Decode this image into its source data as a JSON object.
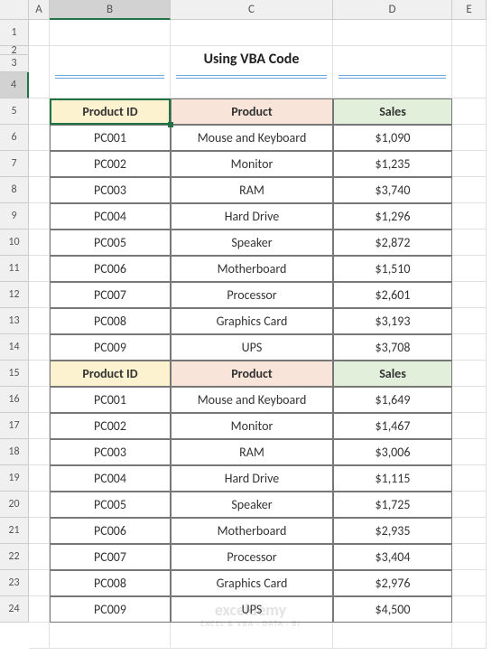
{
  "columns": [
    "A",
    "B",
    "C",
    "D",
    "E"
  ],
  "selectedCol": "B",
  "selectedRow": 4,
  "rowCount": 24,
  "title": "Using VBA Code",
  "headers": {
    "b": "Product ID",
    "c": "Product",
    "d": "Sales"
  },
  "block1": [
    {
      "id": "PC001",
      "p": "Mouse and Keyboard",
      "s": "$1,090"
    },
    {
      "id": "PC002",
      "p": "Monitor",
      "s": "$1,235"
    },
    {
      "id": "PC003",
      "p": "RAM",
      "s": "$3,740"
    },
    {
      "id": "PC004",
      "p": "Hard Drive",
      "s": "$1,296"
    },
    {
      "id": "PC005",
      "p": "Speaker",
      "s": "$2,872"
    },
    {
      "id": "PC006",
      "p": "Motherboard",
      "s": "$1,510"
    },
    {
      "id": "PC007",
      "p": "Processor",
      "s": "$2,601"
    },
    {
      "id": "PC008",
      "p": "Graphics Card",
      "s": "$3,193"
    },
    {
      "id": "PC009",
      "p": "UPS",
      "s": "$3,708"
    }
  ],
  "block2": [
    {
      "id": "PC001",
      "p": "Mouse and Keyboard",
      "s": "$1,649"
    },
    {
      "id": "PC002",
      "p": "Monitor",
      "s": "$1,467"
    },
    {
      "id": "PC003",
      "p": "RAM",
      "s": "$3,006"
    },
    {
      "id": "PC004",
      "p": "Hard Drive",
      "s": "$1,115"
    },
    {
      "id": "PC005",
      "p": "Speaker",
      "s": "$1,725"
    },
    {
      "id": "PC006",
      "p": "Motherboard",
      "s": "$2,935"
    },
    {
      "id": "PC007",
      "p": "Processor",
      "s": "$3,404"
    },
    {
      "id": "PC008",
      "p": "Graphics Card",
      "s": "$2,976"
    },
    {
      "id": "PC009",
      "p": "UPS",
      "s": "$4,500"
    }
  ],
  "watermark": {
    "main": "exceldemy",
    "sub": "EXCEL & VBA · DATA · BI"
  },
  "chart_data": {
    "type": "table",
    "title": "Using VBA Code",
    "columns": [
      "Product ID",
      "Product",
      "Sales"
    ],
    "sections": [
      {
        "rows": [
          [
            "PC001",
            "Mouse and Keyboard",
            1090
          ],
          [
            "PC002",
            "Monitor",
            1235
          ],
          [
            "PC003",
            "RAM",
            3740
          ],
          [
            "PC004",
            "Hard Drive",
            1296
          ],
          [
            "PC005",
            "Speaker",
            2872
          ],
          [
            "PC006",
            "Motherboard",
            1510
          ],
          [
            "PC007",
            "Processor",
            2601
          ],
          [
            "PC008",
            "Graphics Card",
            3193
          ],
          [
            "PC009",
            "UPS",
            3708
          ]
        ]
      },
      {
        "rows": [
          [
            "PC001",
            "Mouse and Keyboard",
            1649
          ],
          [
            "PC002",
            "Monitor",
            1467
          ],
          [
            "PC003",
            "RAM",
            3006
          ],
          [
            "PC004",
            "Hard Drive",
            1115
          ],
          [
            "PC005",
            "Speaker",
            1725
          ],
          [
            "PC006",
            "Motherboard",
            2935
          ],
          [
            "PC007",
            "Processor",
            3404
          ],
          [
            "PC008",
            "Graphics Card",
            2976
          ],
          [
            "PC009",
            "UPS",
            4500
          ]
        ]
      }
    ]
  }
}
